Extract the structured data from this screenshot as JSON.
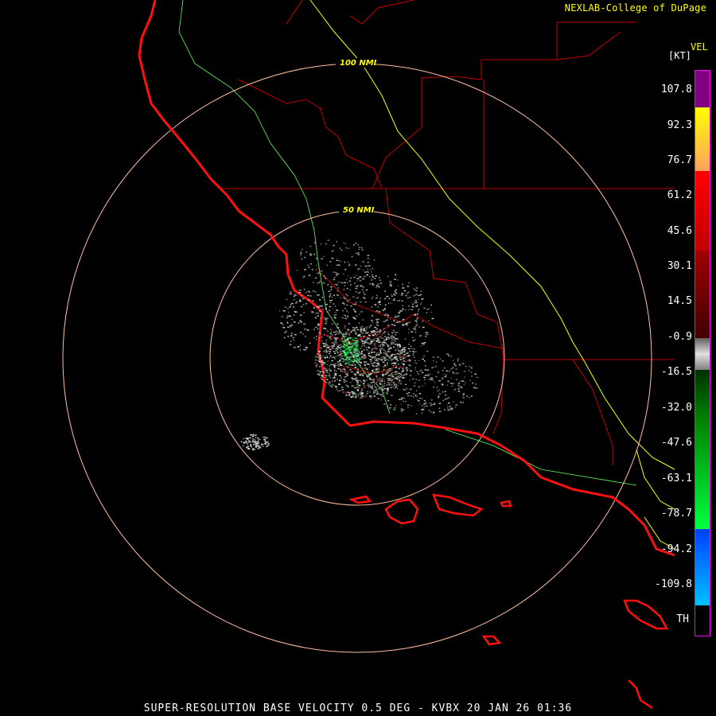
{
  "header": {
    "credit": "NEXLAB-College of DuPage",
    "units_code": "VEL",
    "units": "[KT]"
  },
  "rings": [
    "100 NMI",
    "50 NMI"
  ],
  "legend": {
    "ticks": [
      "107.8",
      "92.3",
      "76.7",
      "61.2",
      "45.6",
      "30.1",
      "14.5",
      "-0.9",
      "-16.5",
      "-32.0",
      "-47.6",
      "-63.1",
      "-78.7",
      "-94.2",
      "-109.8",
      "TH"
    ],
    "colors": {
      "purple": "#800080",
      "yellow": "#ffff00",
      "orange": "#ffa060",
      "red": "#ff0000",
      "dark_red": "#600000",
      "gray": "#c0c0c0",
      "dark_green": "#006000",
      "green": "#00ff40",
      "blue": "#0050ff",
      "cyan": "#00c0ff",
      "coast": "#ff1010",
      "highway": "#ffff00",
      "county": "#c00000",
      "river": "#60ff60",
      "ring": "#ffc0a0"
    }
  },
  "footer": {
    "caption": "SUPER-RESOLUTION BASE VELOCITY 0.5 DEG - KVBX 20 JAN 26 01:36"
  }
}
